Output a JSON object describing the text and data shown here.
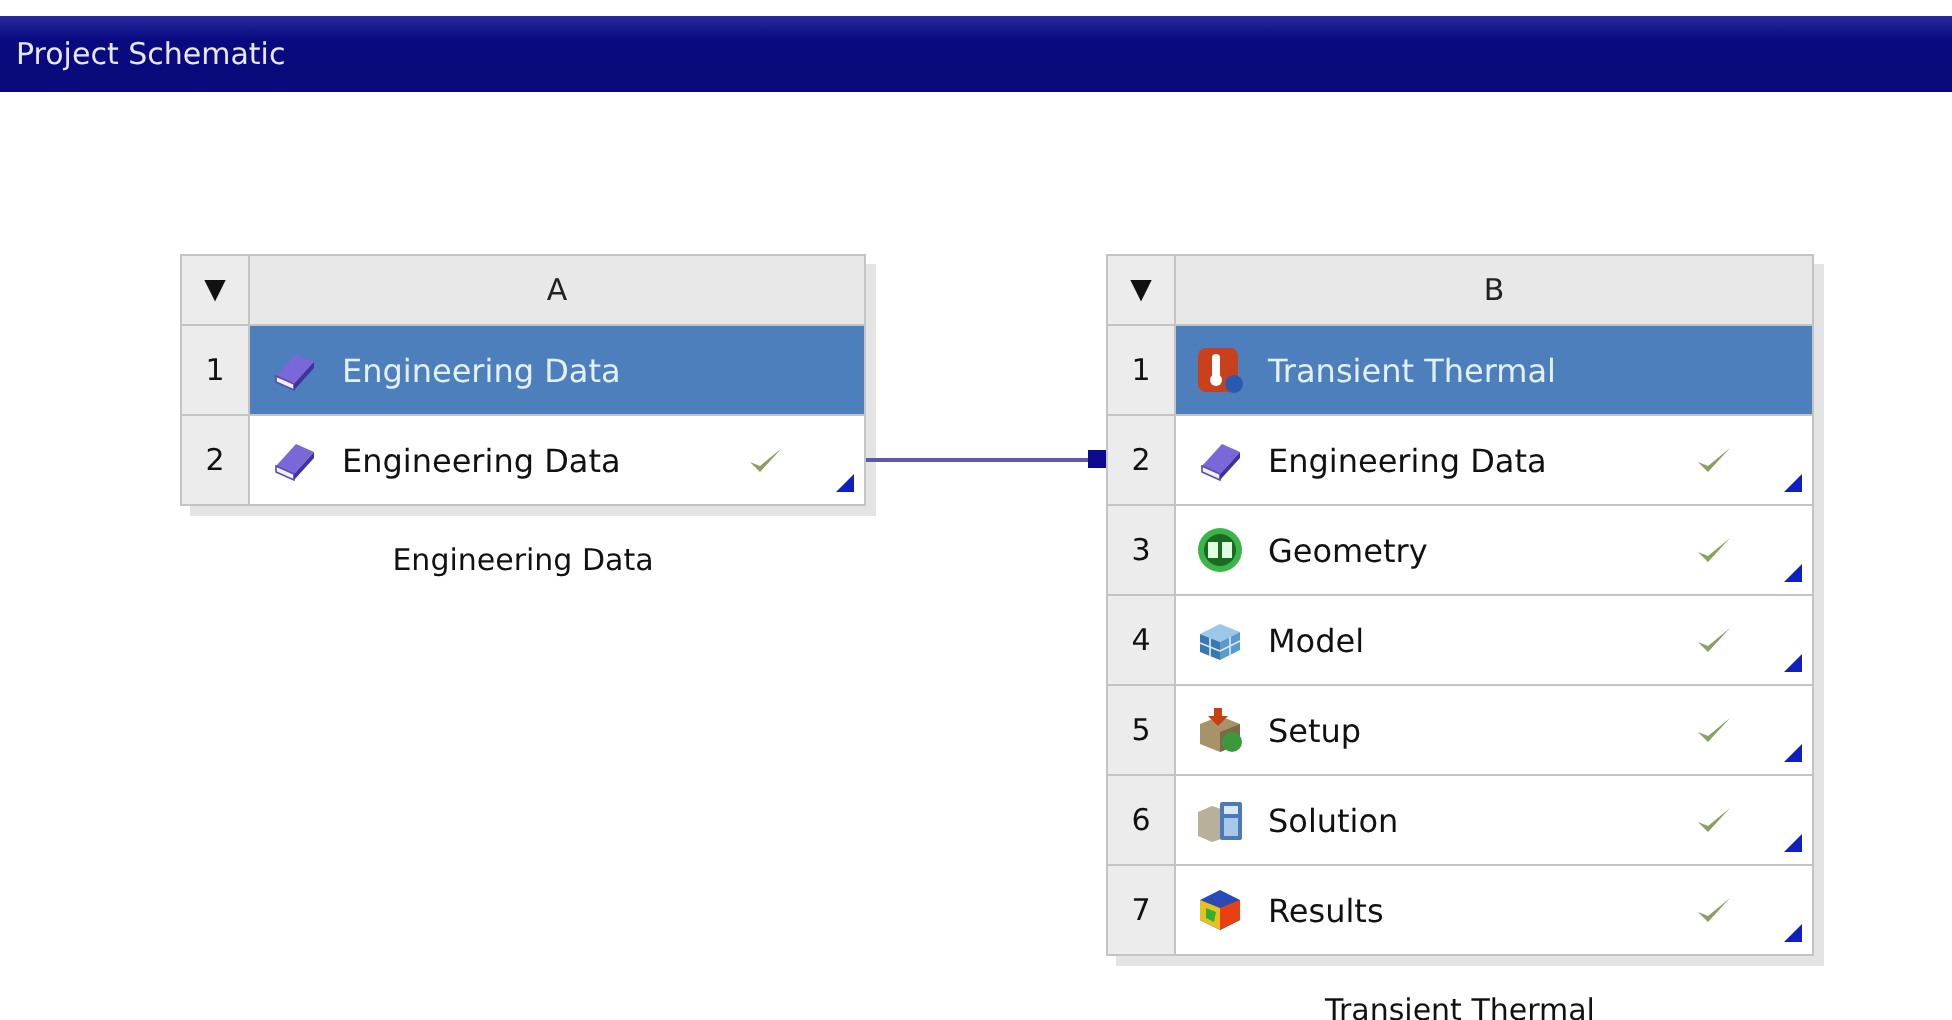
{
  "window": {
    "title": "Project Schematic"
  },
  "systems": [
    {
      "column": "A",
      "menu_glyph": "▼",
      "caption": "Engineering Data",
      "rows": [
        {
          "number": "1",
          "label": "Engineering Data",
          "kind": "engineering_data",
          "selected": true,
          "up_to_date": false,
          "link_source": false,
          "link_target": false
        },
        {
          "number": "2",
          "label": "Engineering Data",
          "kind": "engineering_data",
          "selected": false,
          "up_to_date": true,
          "link_source": true,
          "link_target": false
        }
      ]
    },
    {
      "column": "B",
      "menu_glyph": "▼",
      "caption": "Transient Thermal",
      "rows": [
        {
          "number": "1",
          "label": "Transient Thermal",
          "kind": "thermal",
          "selected": true,
          "up_to_date": false,
          "link_source": false,
          "link_target": false
        },
        {
          "number": "2",
          "label": "Engineering Data",
          "kind": "engineering_data",
          "selected": false,
          "up_to_date": true,
          "link_source": false,
          "link_target": true
        },
        {
          "number": "3",
          "label": "Geometry",
          "kind": "geometry",
          "selected": false,
          "up_to_date": true,
          "link_source": false,
          "link_target": false
        },
        {
          "number": "4",
          "label": "Model",
          "kind": "model",
          "selected": false,
          "up_to_date": true,
          "link_source": false,
          "link_target": false
        },
        {
          "number": "5",
          "label": "Setup",
          "kind": "setup",
          "selected": false,
          "up_to_date": true,
          "link_source": false,
          "link_target": false
        },
        {
          "number": "6",
          "label": "Solution",
          "kind": "solution",
          "selected": false,
          "up_to_date": true,
          "link_source": false,
          "link_target": false
        },
        {
          "number": "7",
          "label": "Results",
          "kind": "results",
          "selected": false,
          "up_to_date": true,
          "link_source": false,
          "link_target": false
        }
      ]
    }
  ]
}
